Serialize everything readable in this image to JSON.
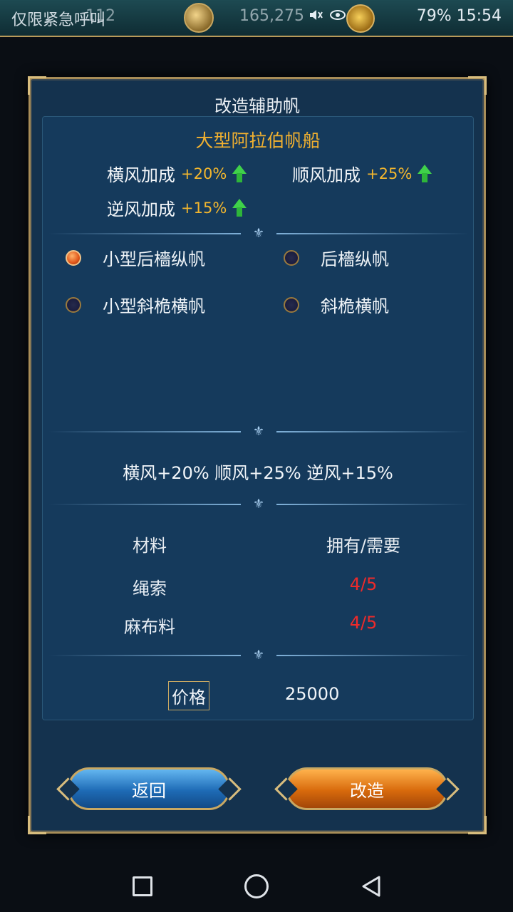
{
  "status_bar": {
    "left_text": "仅限紧急呼叫",
    "level": "112",
    "money": "165,275",
    "right_text": "79% 15:54"
  },
  "dialog": {
    "title": "改造辅助帆",
    "ship_name": "大型阿拉伯帆船",
    "bonuses": [
      {
        "label": "横风加成",
        "value": "+20%"
      },
      {
        "label": "顺风加成",
        "value": "+25%"
      },
      {
        "label": "逆风加成",
        "value": "+15%"
      }
    ],
    "options": [
      {
        "label": "小型后檣纵帆",
        "selected": true
      },
      {
        "label": "后檣纵帆",
        "selected": false
      },
      {
        "label": "小型斜桅横帆",
        "selected": false
      },
      {
        "label": "斜桅横帆",
        "selected": false
      }
    ],
    "summary": "横风+20%  顺风+25%  逆风+15%",
    "materials": {
      "header_name": "材料",
      "header_count": "拥有/需要",
      "rows": [
        {
          "name": "绳索",
          "count": "4/5"
        },
        {
          "name": "麻布料",
          "count": "4/5"
        }
      ]
    },
    "price_label": "价格",
    "price_value": "25000",
    "back_button": "返回",
    "modify_button": "改造"
  },
  "colors": {
    "accent_gold": "#f0b030",
    "insufficient_red": "#ee2a2a",
    "bonus_green": "#3fd14a"
  }
}
